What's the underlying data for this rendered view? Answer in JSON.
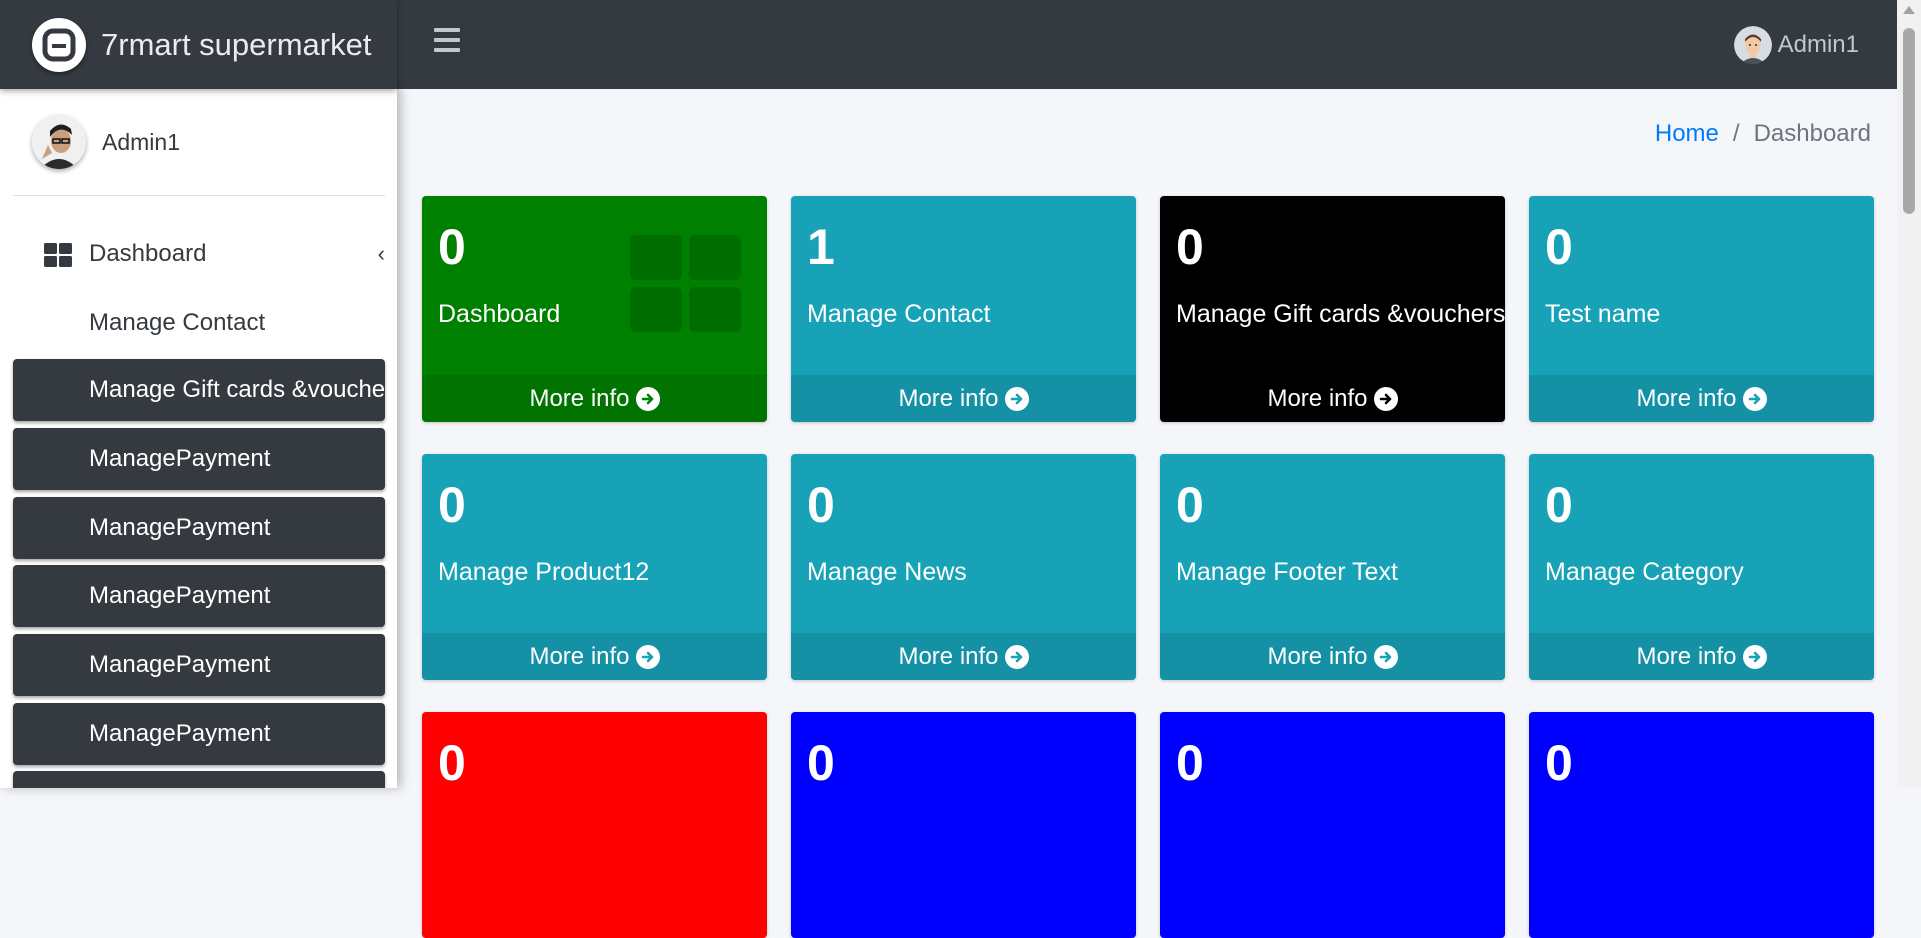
{
  "navbar": {
    "brand": "7rmart supermarket",
    "brand_logo_icon": "letter-a-logo-icon",
    "menu_icon": "hamburger-menu-icon",
    "user_name": "Admin1"
  },
  "sidebar": {
    "user_name": "Admin1",
    "items": [
      {
        "label": "Dashboard",
        "icon": "grid-icon"
      },
      {
        "label": "Manage Contact"
      },
      {
        "label": "Manage Gift cards &vouchers"
      },
      {
        "label": "ManagePayment"
      },
      {
        "label": "ManagePayment"
      },
      {
        "label": "ManagePayment"
      },
      {
        "label": "ManagePayment"
      },
      {
        "label": "ManagePayment"
      }
    ]
  },
  "breadcrumb": {
    "home": "Home",
    "separator": "/",
    "current": "Dashboard"
  },
  "cards": [
    {
      "count": "0",
      "title": "Dashboard",
      "more": "More info",
      "color": "#008000"
    },
    {
      "count": "1",
      "title": "Manage Contact",
      "more": "More info",
      "color": "#17a2b8"
    },
    {
      "count": "0",
      "title": "Manage Gift cards &vouchers",
      "more": "More info",
      "color": "#000000"
    },
    {
      "count": "0",
      "title": "Test name",
      "more": "More info",
      "color": "#17a2b8"
    },
    {
      "count": "0",
      "title": "Manage Product12",
      "more": "More info",
      "color": "#17a2b8"
    },
    {
      "count": "0",
      "title": "Manage News",
      "more": "More info",
      "color": "#17a2b8"
    },
    {
      "count": "0",
      "title": "Manage Footer Text",
      "more": "More info",
      "color": "#17a2b8"
    },
    {
      "count": "0",
      "title": "Manage Category",
      "more": "More info",
      "color": "#17a2b8"
    },
    {
      "count": "0",
      "color": "#ff0000"
    },
    {
      "count": "0",
      "color": "#0000ff"
    },
    {
      "count": "0",
      "color": "#0000ff"
    },
    {
      "count": "0",
      "color": "#0000ff"
    }
  ]
}
